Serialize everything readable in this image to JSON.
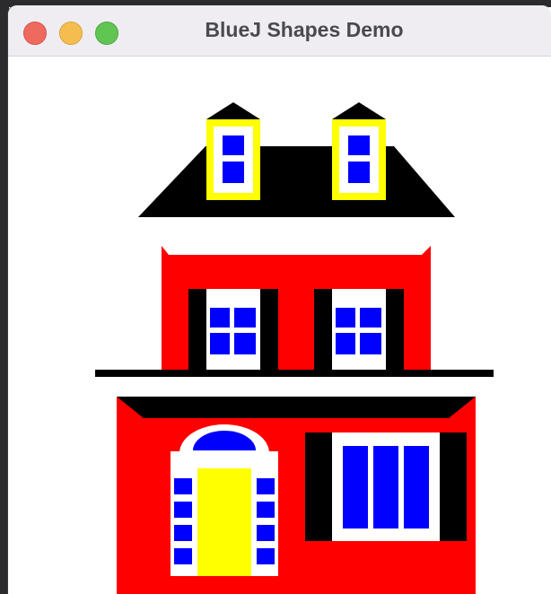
{
  "window": {
    "title": "BlueJ Shapes Demo",
    "controls": [
      "close",
      "minimize",
      "maximize"
    ]
  },
  "colors": {
    "wall": "#ff0000",
    "roof": "#000000",
    "window_glass": "#0000ff",
    "window_frame": "#ffffff",
    "shutter": "#000000",
    "dormer_frame": "#ffff00",
    "door": "#ffff00",
    "traffic_close": "#ee6a5f",
    "traffic_min": "#f5bd4f",
    "traffic_max": "#61c554"
  }
}
